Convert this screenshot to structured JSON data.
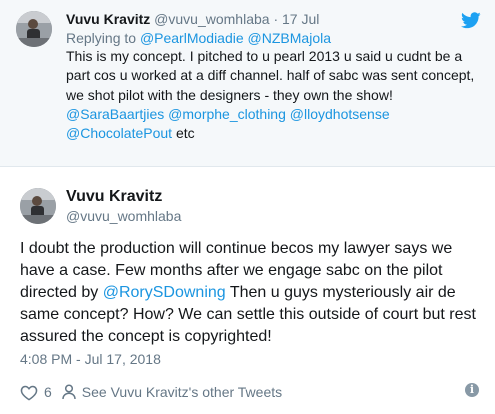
{
  "colors": {
    "link": "#1b95e0",
    "muted": "#657786",
    "parent_bg": "#f5f8fa",
    "bird": "#1da1f2"
  },
  "parent": {
    "name": "Vuvu Kravitz",
    "handle": "@vuvu_womhlaba",
    "dot": "·",
    "date": "17 Jul",
    "replying_prefix": "Replying to ",
    "replying_to": [
      "@PearlModiadie",
      "@NZBMajola"
    ],
    "text_main": "This is my concept. I pitched to u pearl 2013 u said u cudnt be a part cos u worked at a diff channel. half of sabc was sent concept, we shot pilot with the designers - they own the show!",
    "mentions": [
      "@SaraBaartjies",
      "@morphe_clothing",
      "@lloydhotsense",
      "@ChocolatePout"
    ],
    "text_suffix": " etc"
  },
  "tweet": {
    "name": "Vuvu Kravitz",
    "handle": "@vuvu_womhlaba",
    "text_before": "I doubt the production will continue becos my lawyer says we have a case. Few months after we engage sabc on the pilot directed by ",
    "mention": "@RorySDowning",
    "text_after": " Then u guys mysteriously air de same concept? How? We can settle this outside of court but rest assured the concept is copyrighted!",
    "timestamp": "4:08 PM - Jul 17, 2018",
    "likes": "6",
    "see_more": "See Vuvu Kravitz's other Tweets",
    "info_glyph": "i"
  },
  "icons": [
    "twitter-bird-icon",
    "heart-icon",
    "person-icon",
    "info-icon"
  ]
}
